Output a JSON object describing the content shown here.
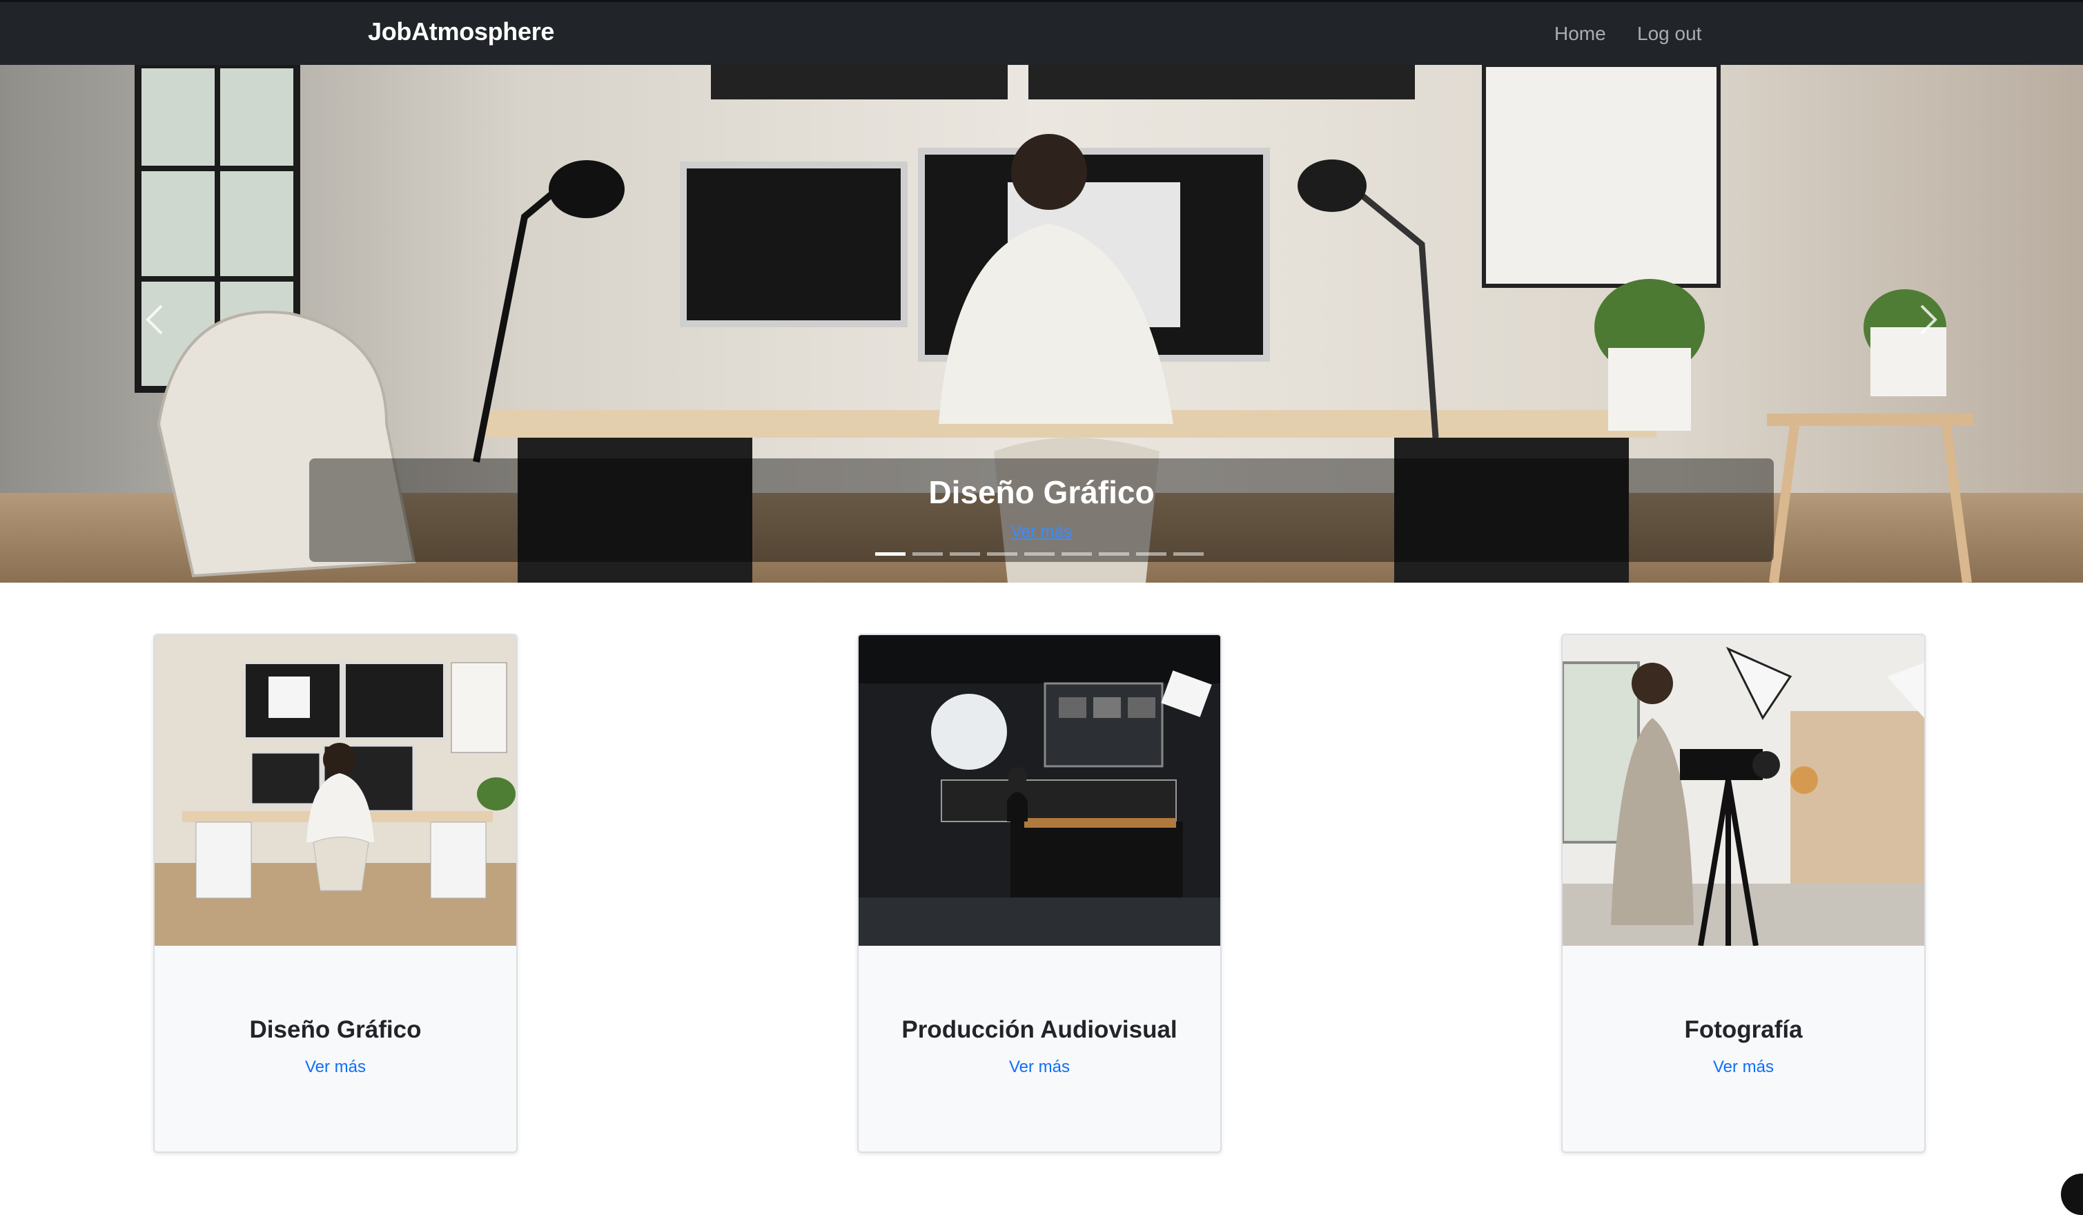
{
  "navbar": {
    "brand": "JobAtmosphere",
    "links": [
      {
        "label": "Home"
      },
      {
        "label": "Log out"
      }
    ]
  },
  "carousel": {
    "active_index": 0,
    "indicator_count": 9,
    "slide": {
      "title": "Diseño Gráfico",
      "link_label": "Ver más"
    }
  },
  "cards": [
    {
      "title": "Diseño Gráfico",
      "link_label": "Ver más"
    },
    {
      "title": "Producción Audiovisual",
      "link_label": "Ver más"
    },
    {
      "title": "Fotografía",
      "link_label": "Ver más"
    }
  ],
  "colors": {
    "navbar_bg": "#212529",
    "link_blue": "#0d6efd",
    "card_bg": "#f8f9fa"
  }
}
